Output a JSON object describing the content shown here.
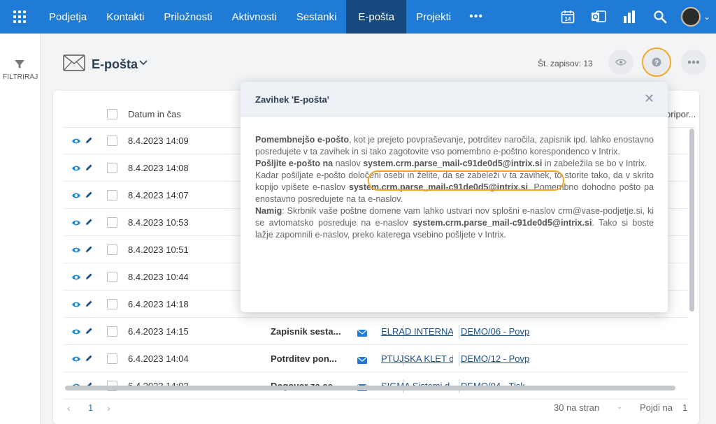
{
  "nav": {
    "items": [
      "Podjetja",
      "Kontakti",
      "Priložnosti",
      "Aktivnosti",
      "Sestanki",
      "E-pošta",
      "Projekti"
    ],
    "active": "E-pošta",
    "more": "•••",
    "calendar_day": "14"
  },
  "sidebar": {
    "filter_label": "FILTRIRAJ"
  },
  "header": {
    "title": "E-pošta",
    "record_count": "Št. zapisov: 13"
  },
  "table": {
    "col_date": "Datum in čas",
    "col_partial": "pripor...",
    "rows": [
      {
        "date": "8.4.2023 14:09",
        "subject": "",
        "company": "",
        "project": ""
      },
      {
        "date": "8.4.2023 14:08",
        "subject": "",
        "company": "",
        "project": ""
      },
      {
        "date": "8.4.2023 14:07",
        "subject": "",
        "company": "",
        "project": ""
      },
      {
        "date": "8.4.2023 10:53",
        "subject": "",
        "company": "",
        "project": ""
      },
      {
        "date": "8.4.2023 10:51",
        "subject": "",
        "company": "",
        "project": ""
      },
      {
        "date": "8.4.2023 10:44",
        "subject": "",
        "company": "",
        "project": ""
      },
      {
        "date": "6.4.2023 14:18",
        "subject": "",
        "company": "",
        "project": ""
      },
      {
        "date": "6.4.2023 14:15",
        "subject": "Zapisnik sesta...",
        "company": "ELRAD INTERNA",
        "project": "DEMO/06 - Povp"
      },
      {
        "date": "6.4.2023 14:04",
        "subject": "Potrditev pon...",
        "company": "PTUJSKA KLET d",
        "project": "DEMO/12 - Povp"
      },
      {
        "date": "6.4.2023 14:03",
        "subject": "Dogovor za se...",
        "company": "SIGMA Sistemi d",
        "project": "DEMO/04 - Tisk"
      }
    ]
  },
  "footer": {
    "prev": "‹",
    "page": "1",
    "next": "›",
    "per_page": "30 na stran",
    "goto_label": "Pojdi na",
    "goto_value": "1"
  },
  "popover": {
    "title": "Zavihek 'E-pošta'",
    "close": "✕",
    "p1_bold": "Pomembnejšo e-pošto",
    "p1_text": ", kot je prejeto povpraševanje, potrditev naročila, zapisnik ipd. lahko enostavno posredujete v ta zavihek in si tako zagotovite vso pomembno e-poštno korespondenco v Intrix.",
    "p2_bold": "Pošljite e-pošto na",
    "p2_pre": " naslov ",
    "email": "system.crm.parse_mail-c91de0d5@intrix.si",
    "p2_post": " in zabeležila se bo v Intrix.",
    "p3_pre": "Kadar pošiljate e-pošto določeni osebi in želite, da se zabeleži v ta zavihek, to storite tako, da v skrito kopijo vpišete e-naslov ",
    "p3_post": ". Pomembno dohodno pošto pa enostavno posredujete na ta e-naslov.",
    "p4_bold": "Namig",
    "p4_pre": ": Skrbnik vaše poštne domene vam lahko ustvari nov splošni e-naslov crm@vase-podjetje.si, ki se avtomatsko posreduje na e-naslov ",
    "p4_post": ". Tako si boste lažje zapomnili e-naslov, preko katerega vsebino pošljete v Intrix."
  },
  "colors": {
    "nav_bg": "#1f7bd6",
    "nav_active": "#16497e",
    "highlight": "#f5a623",
    "link": "#1a4f8c"
  }
}
